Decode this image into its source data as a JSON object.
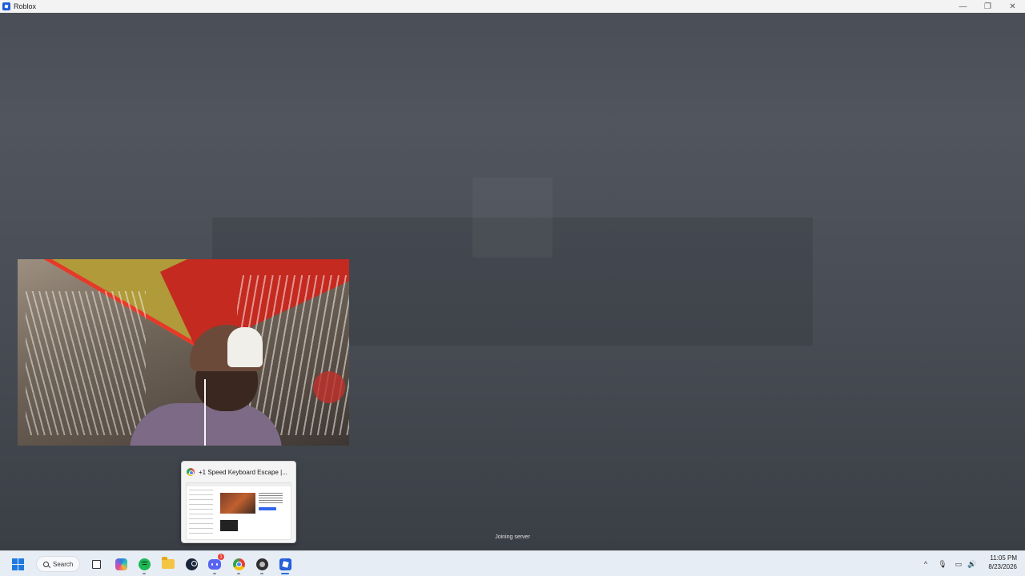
{
  "window": {
    "title": "Roblox",
    "minimize": "—",
    "maximize": "❐",
    "close": "✕"
  },
  "game": {
    "status_text": "Joining server"
  },
  "preview": {
    "tab_title": "+1 Speed Keyboard Escape |..."
  },
  "taskbar": {
    "search_label": "Search",
    "discord_badge": "1",
    "clock_time": "11:05 PM",
    "clock_date": "8/23/2026",
    "tray_chevron": "^"
  }
}
